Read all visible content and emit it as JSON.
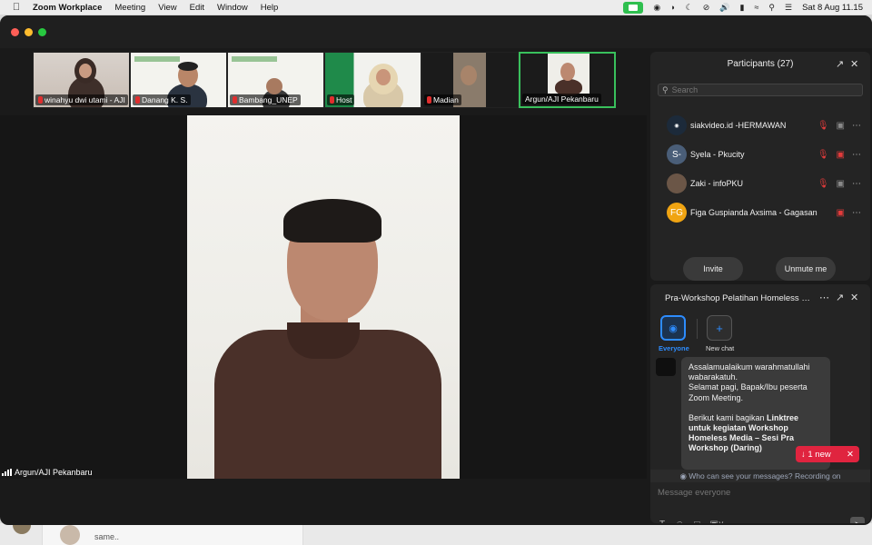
{
  "menubar": {
    "app_name": "Zoom Workplace",
    "items": [
      "Meeting",
      "View",
      "Edit",
      "Window",
      "Help"
    ],
    "clock": "Sat 8 Aug  11.15"
  },
  "thumbnails": [
    {
      "name": "winahyu dwi utami - AJI",
      "muted": true
    },
    {
      "name": "Danang K. S.",
      "muted": true
    },
    {
      "name": "Bambang_UNEP",
      "muted": true
    },
    {
      "name": "Host",
      "muted": true
    },
    {
      "name": "Madian",
      "muted": true
    },
    {
      "name": "Argun/AJI Pekanbaru",
      "muted": false
    }
  ],
  "main_video": {
    "speaker_label": "Argun/AJI Pekanbaru"
  },
  "participants": {
    "title": "Participants (27)",
    "search_placeholder": "Search",
    "rows": [
      {
        "name": "siakvideo.id -HERMAWAN",
        "avatar_text": "",
        "avatar_color": "#1c2a3a"
      },
      {
        "name": "Syela - Pkucity",
        "avatar_text": "S-",
        "avatar_color": "#4a5e78"
      },
      {
        "name": "Zaki - infoPKU",
        "avatar_text": "",
        "avatar_color": "#6b5647"
      },
      {
        "name": "Figa Guspianda Axsima - Gagasan",
        "avatar_text": "FG",
        "avatar_color": "#f0a412"
      }
    ],
    "invite_label": "Invite",
    "unmute_label": "Unmute me"
  },
  "chat": {
    "title": "Pra-Workshop Pelatihan Homeless Me...",
    "tabs": [
      {
        "label": "Everyone",
        "active": true
      },
      {
        "label": "New chat",
        "active": false
      }
    ],
    "message_lines": [
      "Assalamualaikum warahmatullahi",
      "wabarakatuh.",
      "Selamat pagi, Bapak/Ibu peserta",
      "Zoom Meeting."
    ],
    "message_lines_2_normal": "Berikut kami bagikan ",
    "message_lines_2_bold": "Linktree untuk kegiatan Workshop Homeless Media – Sesi Pra Workshop (Daring)",
    "new_pill": "↓  1 new",
    "visibility_note": "Who can see your messages? Recording on",
    "input_placeholder": "Message everyone"
  },
  "background": {
    "under_text": "same.."
  },
  "colors": {
    "accent_blue": "#2d8cff",
    "mute_red": "#e23b3b",
    "active_speaker_green": "#39c05c",
    "new_pill_red": "#e0243f"
  }
}
